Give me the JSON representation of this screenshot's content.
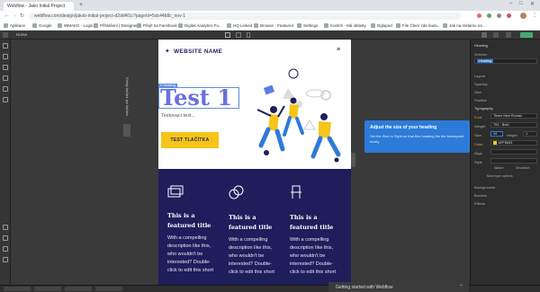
{
  "browser": {
    "tabs": [
      {
        "label": "Webflow - Jako Initial Project"
      }
    ],
    "url": "webflow.com/design/jakob-initial-project-d2dd4f1c?pageId=5dc44b8c_nov-1",
    "bookmarks": [
      "Aplikace",
      "Google",
      "WMAKG - Login",
      "Přihlášení | Designer",
      "Přejít na Facebook",
      "Digital Analytics Fu...",
      "HQ Linked",
      "Browse - Featured",
      "Importování z Firef...",
      "Settings",
      "Kontch - Má oblasty",
      "Dglopod",
      "File Čtení zde budu...",
      "Jak na reklamu na ..."
    ]
  },
  "webflow": {
    "page_title": "Home",
    "site": {
      "logo_text": "WEBSITE NAME",
      "heading_tag": "H Heading",
      "heading": "Test 1",
      "subtext": "Testovací text...",
      "button_label": "TEST TLAČÍTKA",
      "vertical_label": "Efekty tlačítek pro tlačítko",
      "features": [
        {
          "icon": "browser-windows-icon",
          "title": "This is a featured title",
          "desc": "With a compelling description like this, who wouldn't be interested? Double-click to edit this short"
        },
        {
          "icon": "coins-icon",
          "title": "This is a featured title",
          "desc": "With a compelling description like this, who wouldn't be interested? Double-click to edit this short"
        },
        {
          "icon": "chair-icon",
          "title": "This is a featured title",
          "desc": "With a compelling description like this, who wouldn't be interested? Double-click to edit this short"
        }
      ]
    },
    "tooltip": {
      "title": "Adjust the size of your heading",
      "body": "Set the Size in Style so that this heading fits the breakpoint nicely."
    },
    "right_panel": {
      "header": "Heading",
      "selector_label": "Selector",
      "selector_value": "Heading",
      "sections": [
        "Layout",
        "Spacing",
        "Size",
        "Position",
        "Typography"
      ],
      "font_label": "Font",
      "font_value": "Times New Roman",
      "weight_label": "Weight",
      "weight_value": "700 - Bold",
      "size_label": "Size",
      "size_value": "44",
      "height_label": "Height",
      "height_value": "1",
      "color_label": "Color",
      "color_value": "#FF6633",
      "align_label": "Align",
      "style_label": "Style",
      "italicize_label": "Italicize",
      "decoration_label": "Decoration",
      "more_type_label": "More type options",
      "backgrounds_label": "Backgrounds",
      "borders_label": "Borders",
      "effects_label": "Effects"
    },
    "getting_started": "Getting started with Webflow"
  },
  "colors": {
    "accent_yellow": "#f5c518",
    "hero_blue": "#2d7bd8",
    "navy": "#1e1e5c",
    "heading_color": "#5b6dd6"
  }
}
